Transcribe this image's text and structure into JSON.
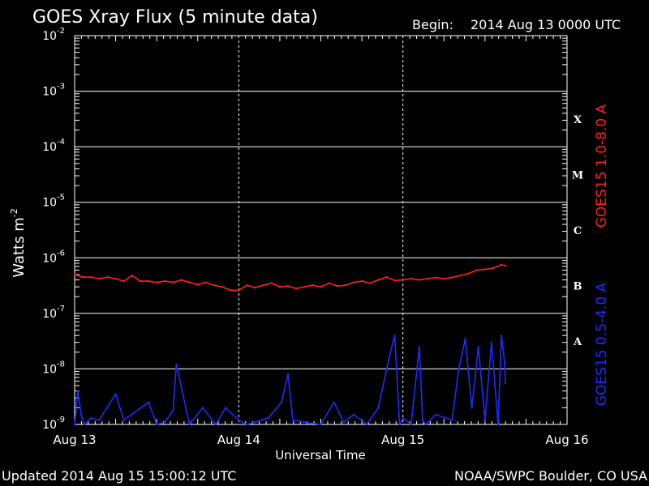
{
  "page": {
    "title": "GOES Xray Flux (5 minute data)",
    "begin_label": "Begin:",
    "begin_value": "2014 Aug 13 0000 UTC",
    "updated": "Updated 2014 Aug 15 15:00:12 UTC",
    "credit": "NOAA/SWPC Boulder, CO USA"
  },
  "chart_data": {
    "type": "line",
    "title": "GOES Xray Flux (5 minute data)",
    "xlabel": "Universal Time",
    "ylabel": "Watts m",
    "ylabel_superscript": "-2",
    "y_scale": "log",
    "ylim": [
      1e-09,
      0.01
    ],
    "x_unit": "days since 2014 Aug 13 00:00 UTC",
    "xlim": [
      0,
      3
    ],
    "x_tick_labels": [
      "Aug 13",
      "Aug 14",
      "Aug 15",
      "Aug 16"
    ],
    "y_tick_labels": [
      {
        "base": "10",
        "exp": "-9"
      },
      {
        "base": "10",
        "exp": "-8"
      },
      {
        "base": "10",
        "exp": "-7"
      },
      {
        "base": "10",
        "exp": "-6"
      },
      {
        "base": "10",
        "exp": "-5"
      },
      {
        "base": "10",
        "exp": "-4"
      },
      {
        "base": "10",
        "exp": "-3"
      },
      {
        "base": "10",
        "exp": "-2"
      }
    ],
    "flare_classes": [
      "A",
      "B",
      "C",
      "M",
      "X"
    ],
    "grid": true,
    "series": [
      {
        "name": "GOES15 1.0-8.0 A",
        "color": "#ff2020",
        "x": [
          0.0,
          0.05,
          0.1,
          0.15,
          0.2,
          0.25,
          0.3,
          0.35,
          0.4,
          0.45,
          0.5,
          0.55,
          0.6,
          0.65,
          0.7,
          0.75,
          0.8,
          0.85,
          0.9,
          0.95,
          1.0,
          1.05,
          1.1,
          1.15,
          1.2,
          1.25,
          1.3,
          1.35,
          1.4,
          1.45,
          1.5,
          1.55,
          1.6,
          1.65,
          1.7,
          1.75,
          1.8,
          1.85,
          1.9,
          1.95,
          2.0,
          2.05,
          2.1,
          2.15,
          2.2,
          2.25,
          2.3,
          2.35,
          2.4,
          2.45,
          2.5,
          2.55,
          2.6,
          2.625
        ],
        "values": [
          5e-07,
          4.5e-07,
          4.5e-07,
          4.2e-07,
          4.5e-07,
          4.2e-07,
          3.8e-07,
          4.8e-07,
          3.8e-07,
          3.8e-07,
          3.6e-07,
          3.8e-07,
          3.6e-07,
          4e-07,
          3.6e-07,
          3.3e-07,
          3.6e-07,
          3.2e-07,
          3e-07,
          2.6e-07,
          2.6e-07,
          3.2e-07,
          2.9e-07,
          3.2e-07,
          3.5e-07,
          3e-07,
          3.1e-07,
          2.8e-07,
          3e-07,
          3.2e-07,
          3e-07,
          3.5e-07,
          3.1e-07,
          3.2e-07,
          3.6e-07,
          3.8e-07,
          3.5e-07,
          4e-07,
          4.5e-07,
          3.9e-07,
          4e-07,
          4.2e-07,
          4e-07,
          4.2e-07,
          4.4e-07,
          4.2e-07,
          4.4e-07,
          4.8e-07,
          5.2e-07,
          6e-07,
          6.2e-07,
          6.5e-07,
          7.5e-07,
          7.2e-07
        ]
      },
      {
        "name": "GOES15 0.5-4.0 A",
        "color": "#1e2cff",
        "x": [
          0.0,
          0.02,
          0.04,
          0.06,
          0.1,
          0.15,
          0.25,
          0.3,
          0.45,
          0.5,
          0.55,
          0.6,
          0.62,
          0.7,
          0.78,
          0.86,
          0.92,
          1.0,
          1.05,
          1.1,
          1.18,
          1.26,
          1.3,
          1.33,
          1.4,
          1.5,
          1.58,
          1.64,
          1.7,
          1.78,
          1.85,
          1.92,
          1.95,
          1.98,
          2.0,
          2.05,
          2.1,
          2.12,
          2.14,
          2.2,
          2.3,
          2.34,
          2.38,
          2.42,
          2.46,
          2.5,
          2.54,
          2.58,
          2.6,
          2.62,
          2.625
        ],
        "values": [
          1e-09,
          4e-09,
          1.5e-09,
          1e-09,
          1.3e-09,
          1.2e-09,
          3.5e-09,
          1.2e-09,
          2.5e-09,
          1e-09,
          1.1e-09,
          1.8e-09,
          1.2e-08,
          1e-09,
          2e-09,
          1e-09,
          2e-09,
          1.2e-09,
          1e-09,
          1.1e-09,
          1.3e-09,
          2.5e-09,
          8e-09,
          1.2e-09,
          1.1e-09,
          1e-09,
          2.5e-09,
          1.1e-09,
          1.5e-09,
          1e-09,
          2e-09,
          1.8e-08,
          4e-08,
          1e-09,
          1.3e-09,
          1e-09,
          2.5e-08,
          1.2e-09,
          1e-09,
          1.5e-09,
          1.2e-09,
          1e-08,
          3.5e-08,
          2e-09,
          2.5e-08,
          1.2e-09,
          3e-08,
          1e-09,
          4e-08,
          1.3e-08,
          5.5e-09
        ]
      }
    ]
  }
}
